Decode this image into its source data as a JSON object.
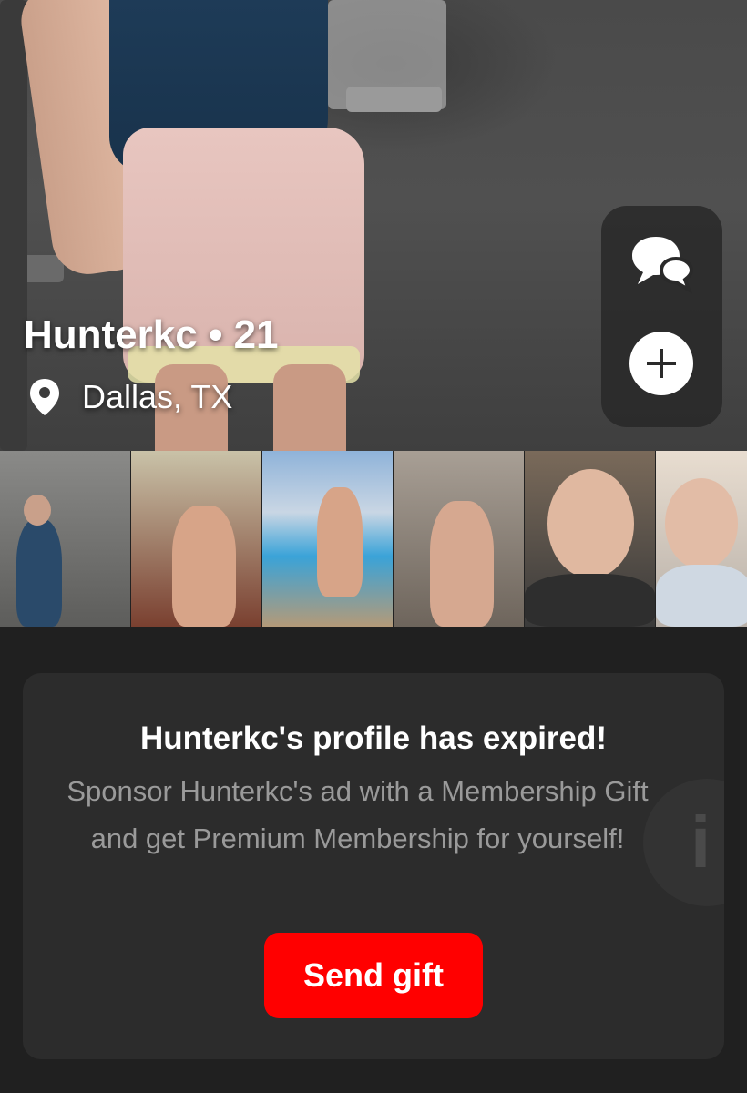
{
  "profile": {
    "name_age": "Hunterkc • 21",
    "location": "Dallas, TX"
  },
  "actions": {
    "chat_icon": "chat-bubbles-icon",
    "add_icon": "plus-circle-icon"
  },
  "thumbnails": [
    {
      "label": "photo-1"
    },
    {
      "label": "photo-2"
    },
    {
      "label": "photo-3"
    },
    {
      "label": "photo-4"
    },
    {
      "label": "photo-5"
    },
    {
      "label": "photo-6"
    }
  ],
  "expired_card": {
    "title": "Hunterkc's profile has expired!",
    "body": "Sponsor Hunterkc's ad with a Membership Gift and get Premium Membership for yourself!",
    "button_label": "Send gift",
    "info_glyph": "i"
  },
  "colors": {
    "accent": "#ff0000",
    "background": "#202020",
    "card": "#2c2c2c"
  }
}
